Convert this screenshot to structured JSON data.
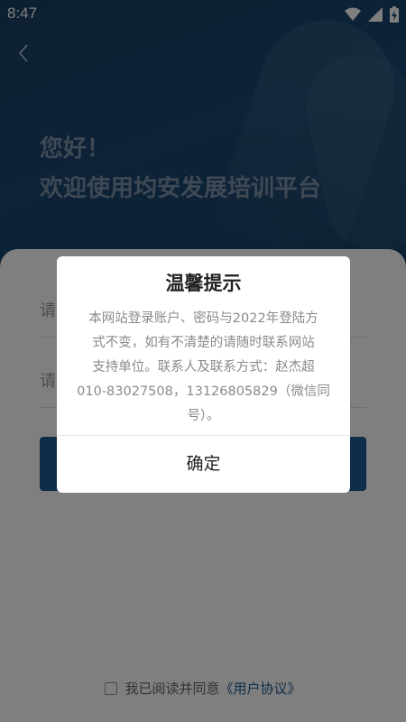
{
  "status_bar": {
    "time": "8:47"
  },
  "header": {
    "greeting_line1": "您好！",
    "greeting_line2": "欢迎使用均安发展培训平台"
  },
  "form": {
    "field1_placeholder_visible": "请",
    "field2_placeholder_visible": "请"
  },
  "agreement": {
    "text": "我已阅读并同意",
    "link": "《用户协议》"
  },
  "dialog": {
    "title": "温馨提示",
    "line1": "本网站登录账户、密码与2022年登陆方",
    "line2": "式不变，如有不清楚的请随时联系网站",
    "line3": "支持单位。联系人及联系方式：赵杰超",
    "line4": "010-83027508，13126805829（微信同",
    "line5": "号）。",
    "confirm": "确定"
  },
  "colors": {
    "accent": "#1f5a94",
    "header_bg": "#1a4670"
  }
}
